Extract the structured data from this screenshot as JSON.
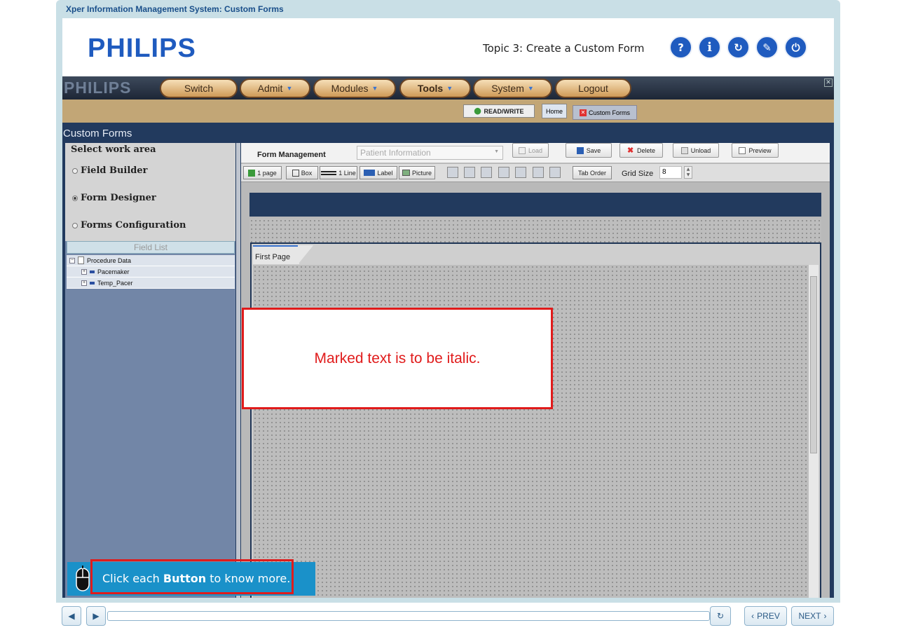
{
  "frame": {
    "title": "Xper Information Management System: Custom Forms"
  },
  "header": {
    "logo": "PHILIPS",
    "topic": "Topic 3: Create a Custom Form",
    "buttons": [
      {
        "name": "help",
        "glyph": "?"
      },
      {
        "name": "info",
        "glyph": "i"
      },
      {
        "name": "replay",
        "glyph": "↻"
      },
      {
        "name": "pen",
        "glyph": "✎"
      },
      {
        "name": "power",
        "glyph": "⏻"
      }
    ]
  },
  "app": {
    "logo": "PHILIPS",
    "menu": [
      {
        "label": "Switch",
        "dropdown": false
      },
      {
        "label": "Admit",
        "dropdown": true
      },
      {
        "label": "Modules",
        "dropdown": true
      },
      {
        "label": "Tools",
        "dropdown": true,
        "bold": true
      },
      {
        "label": "System",
        "dropdown": true
      },
      {
        "label": "Logout",
        "dropdown": false
      }
    ],
    "read_write": "READ/WRITE",
    "tabs": {
      "home": "Home",
      "custom_forms": "Custom Forms"
    },
    "screen_title": "Custom Forms"
  },
  "left_panel": {
    "heading": "Select work area",
    "options": [
      {
        "label": "Field Builder",
        "selected": false
      },
      {
        "label": "Form Designer",
        "selected": true
      },
      {
        "label": "Forms Configuration",
        "selected": false
      }
    ],
    "field_list_button": "Field List",
    "tree": [
      {
        "label": "Procedure Data",
        "level": 0,
        "expander": "−"
      },
      {
        "label": "Pacemaker",
        "level": 1,
        "expander": "+"
      },
      {
        "label": "Temp_Pacer",
        "level": 1,
        "expander": "+"
      }
    ]
  },
  "toolbar": {
    "form_management": "Form Management",
    "form_select_placeholder": "Patient Information",
    "load": "Load",
    "save": "Save",
    "delete": "Delete",
    "unload": "Unload",
    "preview": "Preview"
  },
  "toolbar2": {
    "page": "1 page",
    "box": "Box",
    "line": "1 Line",
    "label": "Label",
    "picture": "Picture",
    "tab_order": "Tab Order",
    "grid_size_label": "Grid Size",
    "grid_size_value": "8"
  },
  "page_tab": "First Page",
  "callout": "Marked text is to be italic.",
  "hint": {
    "prefix": "Click each ",
    "bold": "Button",
    "suffix": " to know more."
  },
  "player": {
    "prev": "PREV",
    "next": "NEXT"
  }
}
